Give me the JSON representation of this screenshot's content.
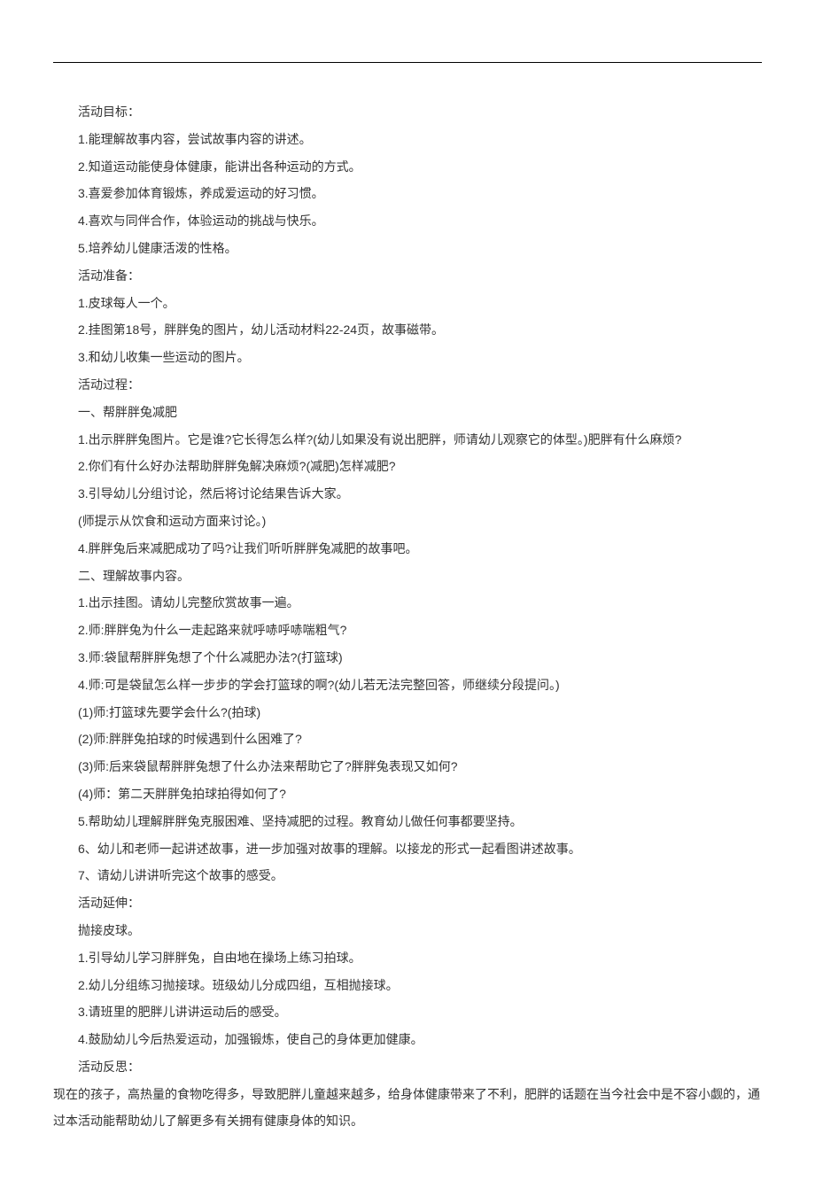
{
  "lines": [
    "活动目标：",
    "1.能理解故事内容，尝试故事内容的讲述。",
    "2.知道运动能使身体健康，能讲出各种运动的方式。",
    "3.喜爱参加体育锻炼，养成爱运动的好习惯。",
    "4.喜欢与同伴合作，体验运动的挑战与快乐。",
    "5.培养幼儿健康活泼的性格。",
    "活动准备：",
    "1.皮球每人一个。",
    "2.挂图第18号，胖胖兔的图片，幼儿活动材料22-24页，故事磁带。",
    "3.和幼儿收集一些运动的图片。",
    "活动过程：",
    "一、帮胖胖兔减肥",
    "1.出示胖胖兔图片。它是谁?它长得怎么样?(幼儿如果没有说出肥胖，师请幼儿观察它的体型。)肥胖有什么麻烦?",
    "2.你们有什么好办法帮助胖胖兔解决麻烦?(减肥)怎样减肥?",
    "3.引导幼儿分组讨论，然后将讨论结果告诉大家。",
    "(师提示从饮食和运动方面来讨论。)",
    "4.胖胖兔后来减肥成功了吗?让我们听听胖胖兔减肥的故事吧。",
    "二、理解故事内容。",
    "1.出示挂图。请幼儿完整欣赏故事一遍。",
    "2.师:胖胖兔为什么一走起路来就呼哧呼哧喘粗气?",
    "3.师:袋鼠帮胖胖兔想了个什么减肥办法?(打篮球)",
    "4.师:可是袋鼠怎么样一步步的学会打篮球的啊?(幼儿若无法完整回答，师继续分段提问。)",
    "(1)师:打篮球先要学会什么?(拍球)",
    "(2)师:胖胖兔拍球的时候遇到什么困难了?",
    "(3)师:后来袋鼠帮胖胖兔想了什么办法来帮助它了?胖胖兔表现又如何?",
    "(4)师：第二天胖胖兔拍球拍得如何了?",
    "5.帮助幼儿理解胖胖兔克服困难、坚持减肥的过程。教育幼儿做任何事都要坚持。",
    "6、幼儿和老师一起讲述故事，进一步加强对故事的理解。以接龙的形式一起看图讲述故事。",
    "7、请幼儿讲讲听完这个故事的感受。",
    "活动延伸：",
    "抛接皮球。",
    "1.引导幼儿学习胖胖兔，自由地在操场上练习拍球。",
    "2.幼儿分组练习抛接球。班级幼儿分成四组，互相抛接球。",
    "3.请班里的肥胖儿讲讲运动后的感受。",
    "4.鼓励幼儿今后热爱运动，加强锻炼，使自己的身体更加健康。",
    "活动反思：",
    "现在的孩子，高热量的食物吃得多，导致肥胖儿童越来越多，给身体健康带来了不利，肥胖的话题在当今社会中是不容小觑的，通过本活动能帮助幼儿了解更多有关拥有健康身体的知识。"
  ],
  "noIndentIndices": [
    36
  ]
}
